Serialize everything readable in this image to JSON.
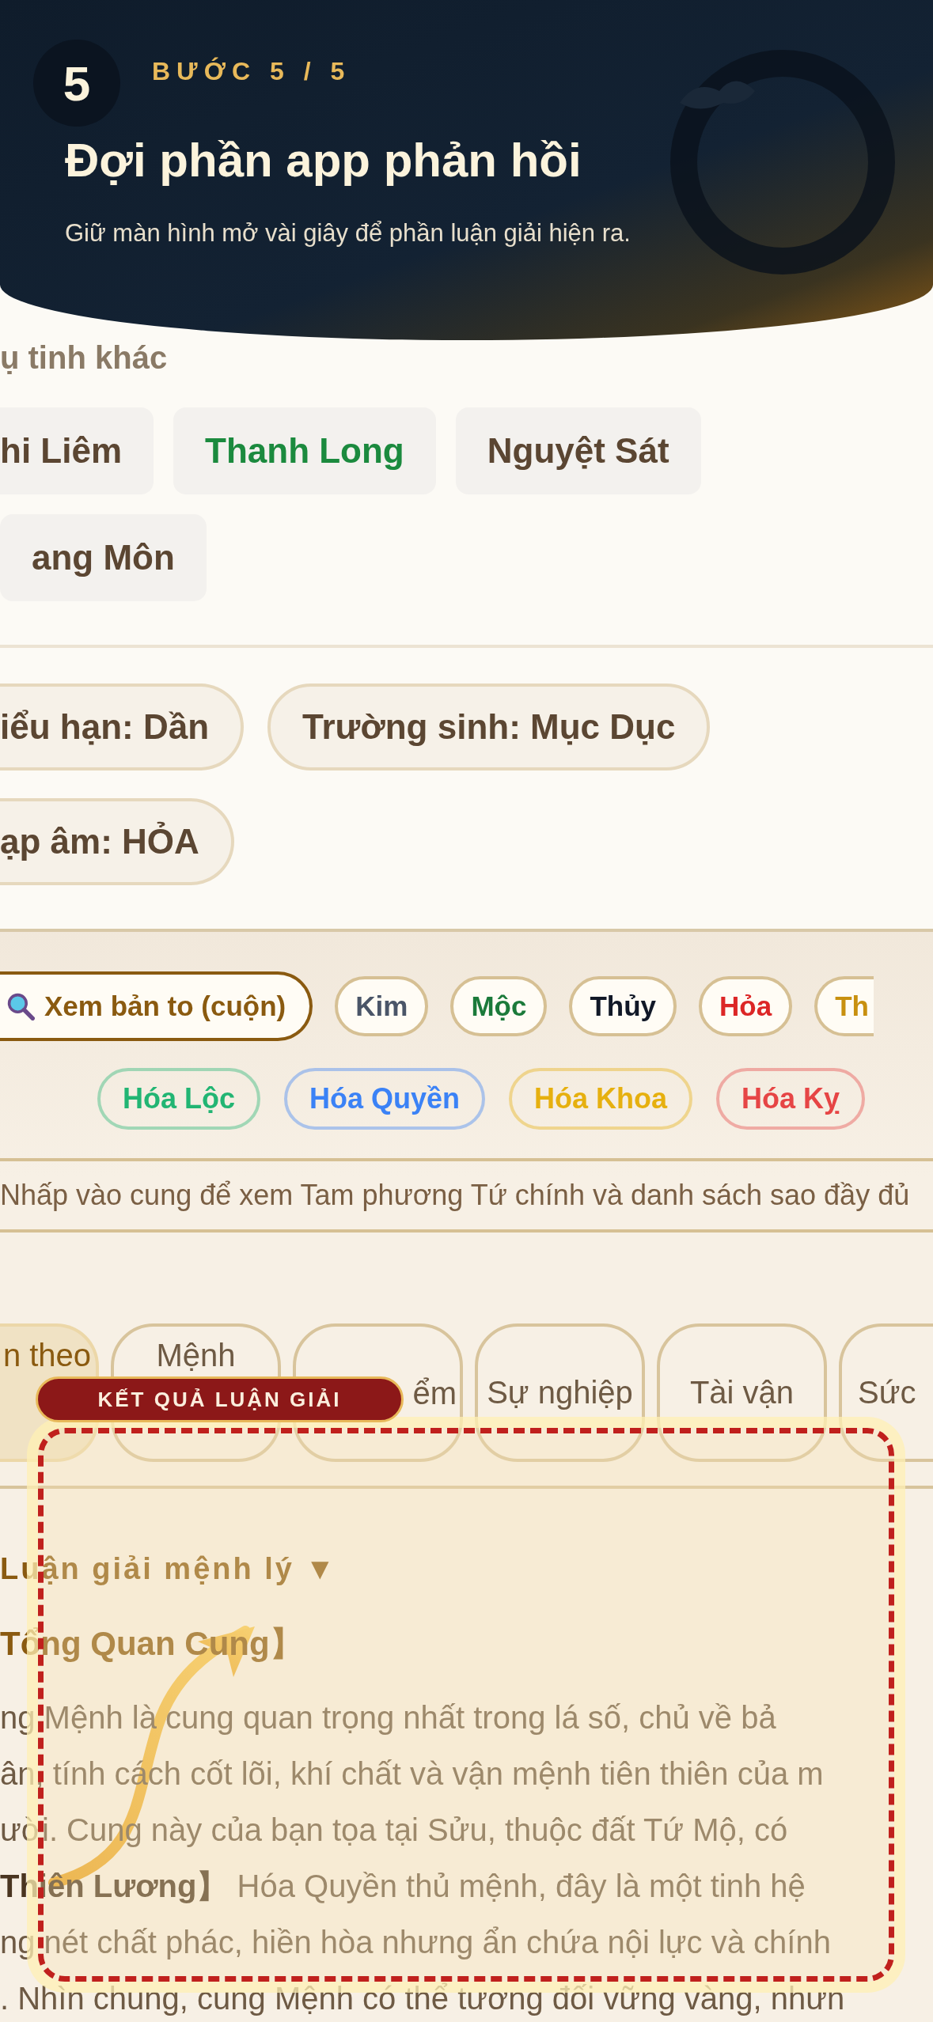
{
  "tutorial": {
    "step_number": "5",
    "step_label": "BƯỚC 5 / 5",
    "title": "Đợi phần app phản hồi",
    "subtitle": "Giữ màn hình mở vài giây để phần luận giải hiện ra.",
    "badge": "KẾT QUẢ LUẬN GIẢI"
  },
  "other_stars": {
    "heading": "ụ tinh khác",
    "stars": [
      {
        "name": "hi Liêm",
        "color": "#5b4632"
      },
      {
        "name": "Thanh Long",
        "color": "#1b8a3e"
      },
      {
        "name": "Nguyệt Sát",
        "color": "#5b4632"
      },
      {
        "name": "ang Môn",
        "color": "#5b4632"
      }
    ]
  },
  "info_pills": [
    "iểu hạn: Dần",
    "Trường sinh: Mục Dục",
    "ạp âm: HỎA"
  ],
  "chart_toolbar": {
    "zoom_button": "Xem bản to (cuộn)",
    "elements": [
      {
        "label": "Kim",
        "color": "#4a5568"
      },
      {
        "label": "Mộc",
        "color": "#1b7a3a"
      },
      {
        "label": "Thủy",
        "color": "#111827"
      },
      {
        "label": "Hỏa",
        "color": "#dc2626"
      },
      {
        "label": "Th",
        "color": "#c8900f"
      }
    ],
    "transformations": [
      {
        "label": "Hóa Lộc",
        "color": "#22b573"
      },
      {
        "label": "Hóa Quyền",
        "color": "#3b82f6"
      },
      {
        "label": "Hóa Khoa",
        "color": "#e6b00f"
      },
      {
        "label": "Hóa Kỵ",
        "color": "#e64545"
      }
    ],
    "hint": "Nhấp vào cung để xem Tam phương Tứ chính và danh sách sao đầy đủ"
  },
  "tabs": [
    {
      "label": "n theo",
      "selected": true
    },
    {
      "label": "Mệnh",
      "selected": false
    },
    {
      "label": "ểm",
      "selected": false
    },
    {
      "label": "Sự nghiệp",
      "selected": false
    },
    {
      "label": "Tài vận",
      "selected": false
    },
    {
      "label": "Sức",
      "selected": false
    }
  ],
  "reading": {
    "toggle": "Luận giải mệnh lý ▼",
    "section_title": "Tổng Quan Cung】",
    "lines": [
      "ng Mệnh là cung quan trọng nhất trong lá số, chủ về bả",
      "ân, tính cách cốt lõi, khí chất và vận mệnh tiên thiên của m",
      "ười. Cung này của bạn tọa tại Sửu, thuộc đất Tứ Mộ, có",
      "**Thiên Lương】** Hóa Quyền thủ mệnh, đây là một tinh hệ",
      "ng nét chất phác, hiền hòa nhưng ẩn chứa nội lực và chính",
      ". Nhìn chung, cung Mệnh có thể tương đối vững vàng, nhưn"
    ]
  }
}
